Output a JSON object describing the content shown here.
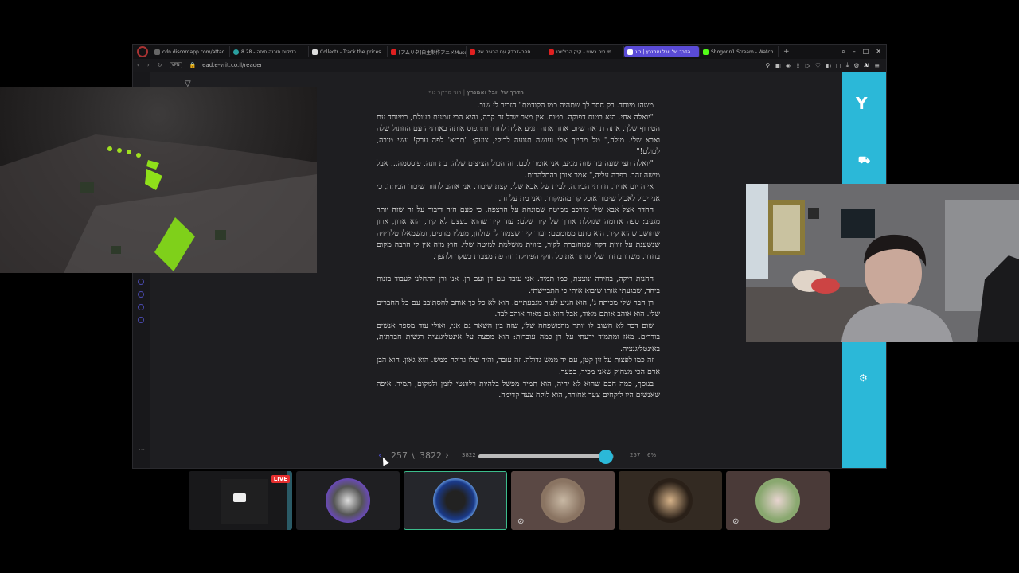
{
  "browser": {
    "tabs": [
      {
        "label": "cdn.discordapp.com/attac",
        "color": "#666666"
      },
      {
        "label": "בדיקות תוכנה חיפה - 8.28",
        "color": "#2aa0a0"
      },
      {
        "label": "Collectr - Track the prices",
        "color": "#dddddd"
      },
      {
        "label": "[アムリタ]自主制作アニメMuse",
        "color": "#e02020"
      },
      {
        "label": "ספרי-דרדק עם הבעיה של",
        "color": "#e02020"
      },
      {
        "label": "מי היה ראשי - קיק הבילינט",
        "color": "#e02020"
      },
      {
        "label": "הדרך של יובל ואמנרץ | רוג",
        "color": "#5a4bd6",
        "active": true
      },
      {
        "label": "Shogonn1 Stream - Watch",
        "color": "#53fc18"
      }
    ],
    "url": "read.e-vrit.co.il/reader",
    "vpn_label": "VPN",
    "ai_label": "AI"
  },
  "reader": {
    "book_title": "הדרך של יובל ואמנרץ",
    "author": "רוני מרקר נוף",
    "paragraphs": [
      "משהו מיוחד. רק חסר לך שתהיה כמו הקודמת\" הזכיר לי שוב.",
      "\"יואלה אחי. היא בטוח דפוקה. בטוח. אין מצב שכל זה קרה, והיא הכי זומנית בעולם, במיוחד עם הטירוף שלך. אתה תראה שיום אחד אתה תגיע אליה לחדר ותתפוס אותה באורגיה עם החתול שלה ואבא שלי. מילה,\" טל מחייך אלי ועושה תנועה לריקי, צועק: \"תביא' לפה ערק! עשי טובה, לכולם!\"",
      "\"יואלה חצי שעה עד שזה מגיע, אני אומר לכם, זה הכול הציצים שלה. בת זונה, פוססמה... אבל משזה זהב. כפרה עליה,\" אמר אורן בהתלהבות.",
      "איזה יום אדיר. חזרתי הביתה, לבית של אבא שלי, קצת שיכור. אני אוהב לחזור שיכור הביתה, כי אני יכול לאכול שיכור אוכל קר מהמקרר, ואני מת על זה.",
      "החדר אצל אבא שלי מורכב ממיטה שמונחת על הרצפה, כי פעם היה דיבור על זה שזה יותר מגניב; ספה אדומה שגוללת אורך של קיר שלם; עוד קיר שהוא בעצם לא קיר, הוא ארון, ארון שחושב שהוא קיר, הוא סתם מטומטם; ועוד קיר שצמוד לו שולחן, מעליו מדפים, ומשמאלו טלוויזיה שנשענת על זווית דקה שמחוברת לקיר, בזווית מושלמת למיטה שלי. חוץ מזה אין לי הרבה מקום בחדר. משהו בחדר שלי סותר את כל חוקי הפיזיקה וזה פה מצבות כשקר ולהפך.",
      "החנות ריקה, בחירה ונוצצת, כמו תמיד. אני עובד עם דן ועם רן. אני ורן התחלנו לעבוד בזנות ביחד, שבגעתי אותו שיבוא איתי כי התביישתי.",
      "רן חבר שלי מכיתה ג', הוא הגיע לעיר מגבעתיים. הוא לא כל כך אוהב להסתובב עם כל החברים שלי. הוא אוהב אותם מאוד, אבל הוא גם מאוד אוהב לבד.",
      "שום דבר לא חשוב לו יותר מהמשפחה שלו, שזה בין השאר גם אני, ואולי עוד מספר אנשים בודדים. מאז ומתמיד ידעתי על רן כמה עובדות: הוא מפצה על אינטליגנציה רגשית חברתית, באינטליגנציה.",
      "זה כמו לפצות על זין קטן, עם יד ממש גדולה. זה עובד, והיד שלו גדולה ממש. הוא גאון. הוא הבן אדם הכי מצחיק שאני מכיר, בפער.",
      "בנוסף, כמה חכם שהוא לא יהיה, הוא תמיד מפשל בלהיות רלוונטי לזמן ולמקום, תמיד. איפה שאנשים היו לוקחים צעד אחורה, הוא לוקח צעד קדימה."
    ],
    "current_page": "257",
    "separator": "\\",
    "total_pages": "3822",
    "total_small": "3822",
    "current_small": "257",
    "percent_label": "6%",
    "progress_fraction": 0.94
  },
  "stream_tiles": [
    {
      "live_label": "LIVE",
      "muted": false
    },
    {
      "muted": false
    },
    {
      "muted": false,
      "selected": true
    },
    {
      "muted": true
    },
    {
      "muted": false
    },
    {
      "muted": true
    }
  ],
  "colors": {
    "accent_cyan": "#2bb8d8",
    "tab_active": "#5a4bd6",
    "live_red": "#e62f2f",
    "selected_green": "#3cbc8c",
    "game_green": "#7fd01a"
  }
}
